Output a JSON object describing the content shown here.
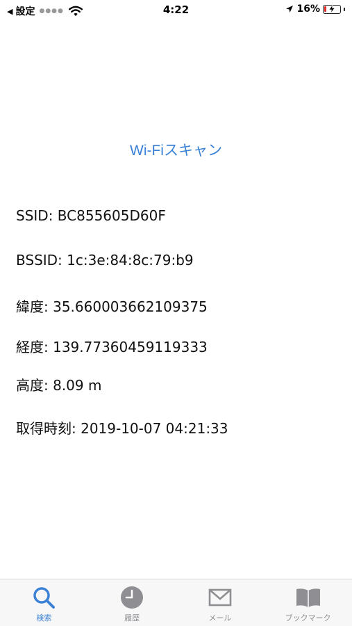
{
  "status_bar": {
    "back_label": "設定",
    "time": "4:22",
    "battery_percent_text": "16%",
    "battery_level": 0.16
  },
  "main": {
    "scan_button_label": "Wi-Fiスキャン",
    "rows": [
      {
        "label": "SSID",
        "value": "BC855605D60F",
        "text": "SSID: BC855605D60F"
      },
      {
        "label": "BSSID",
        "value": "1c:3e:84:8c:79:b9",
        "text": "BSSID: 1c:3e:84:8c:79:b9"
      },
      {
        "label": "緯度",
        "value": "35.660003662109375",
        "text": "緯度: 35.660003662109375"
      },
      {
        "label": "経度",
        "value": "139.77360459119333",
        "text": "経度: 139.77360459119333"
      },
      {
        "label": "高度",
        "value": "8.09 m",
        "text": "高度: 8.09 m"
      },
      {
        "label": "取得時刻",
        "value": "2019-10-07 04:21:33",
        "text": "取得時刻: 2019-10-07 04:21:33"
      }
    ]
  },
  "tab_bar": {
    "tabs": [
      {
        "label": "検索",
        "icon": "search-icon",
        "active": true
      },
      {
        "label": "履歴",
        "icon": "clock-icon",
        "active": false
      },
      {
        "label": "メール",
        "icon": "mail-icon",
        "active": false
      },
      {
        "label": "ブックマーク",
        "icon": "book-icon",
        "active": false
      }
    ]
  },
  "colors": {
    "accent": "#3b82d6",
    "inactive": "#8e8e93",
    "battery_low": "#e0312e"
  }
}
